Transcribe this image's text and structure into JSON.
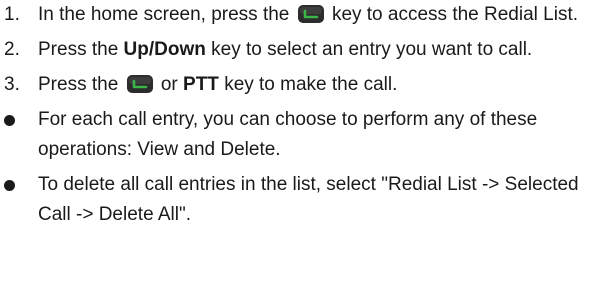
{
  "steps": [
    {
      "number": "1.",
      "text_before": "In the home screen, press the",
      "icon": "send-key-icon",
      "text_after": "key to access the Redial List."
    },
    {
      "number": "2.",
      "text_before": "Press the",
      "bold": "Up",
      "sep": "/",
      "bold2": "Down",
      "text_after": "key to select an entry you want to call."
    },
    {
      "number": "3.",
      "text_before": "Press the",
      "icon": "send-key-icon",
      "text_middle": "or",
      "bold": "PTT",
      "text_after": "key to make the call."
    }
  ],
  "notes": [
    "For each call entry, you can choose to perform any of these operations: View and Delete.",
    "To delete all call entries in the list, select \"Redial List -> Selected Call -> Delete All\"."
  ],
  "colors": {
    "text": "#1a1a1a",
    "key_body": "#2c2c2c",
    "key_accent": "#39b54a"
  }
}
